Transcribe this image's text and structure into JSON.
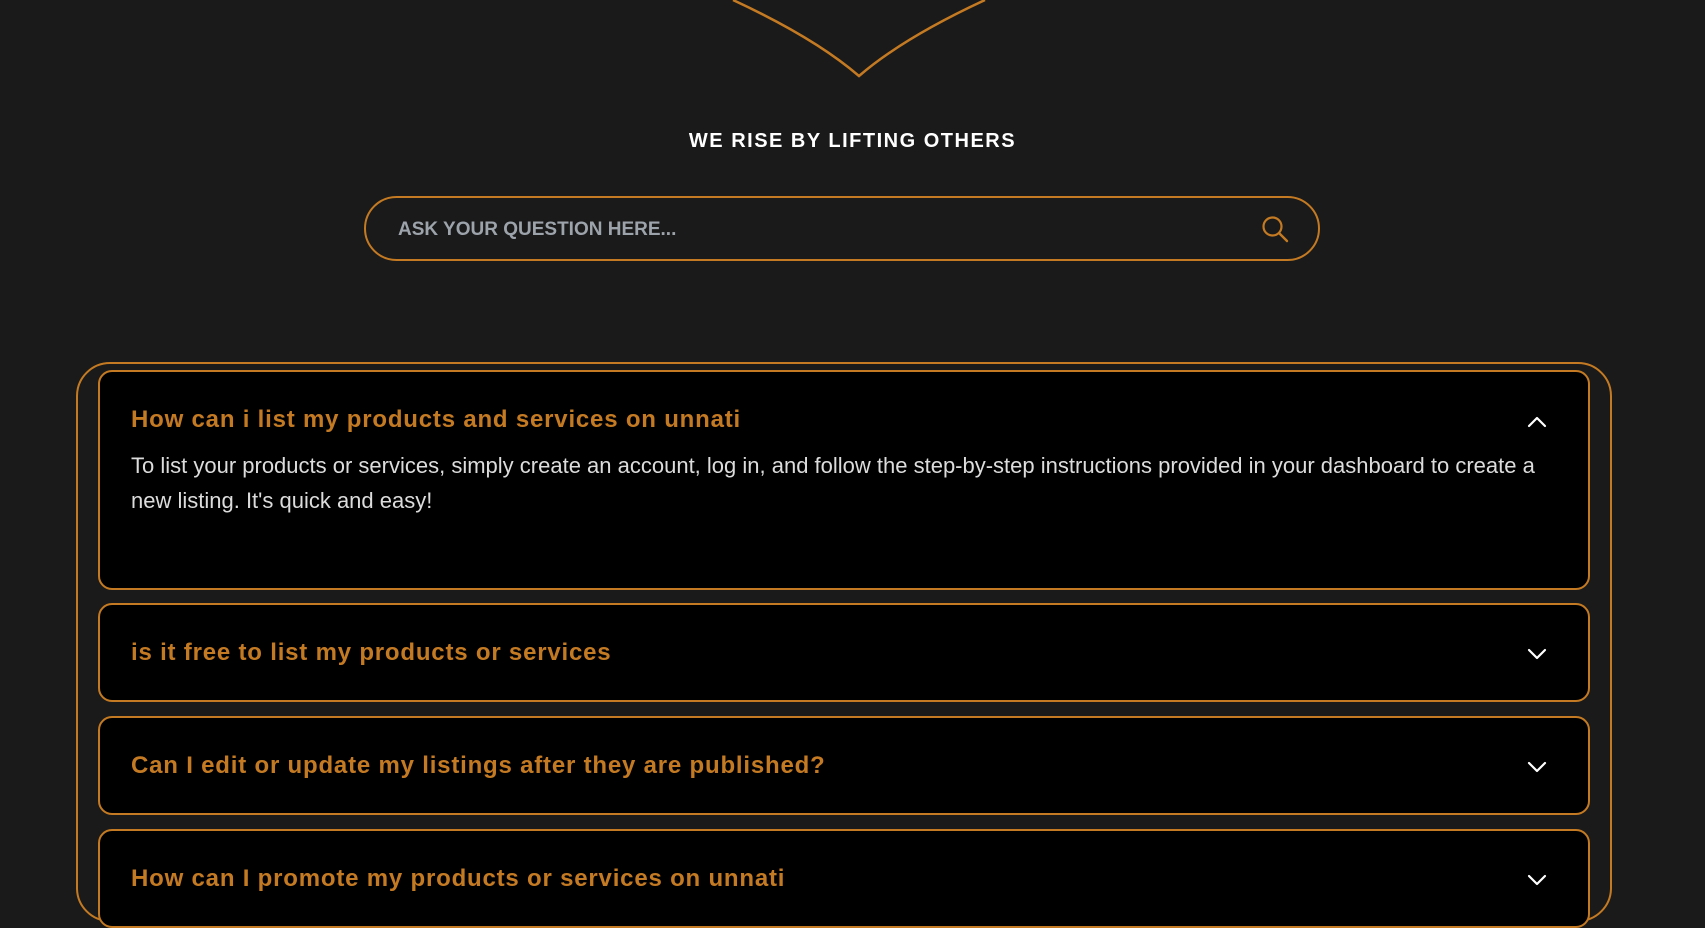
{
  "tagline": "WE RISE BY LIFTING OTHERS",
  "search": {
    "placeholder": "ASK YOUR QUESTION HERE...",
    "icon": "search-icon"
  },
  "colors": {
    "accent": "#c47a22",
    "background": "#1a1a1a",
    "card_background": "#000000",
    "heading_text": "#ffffff",
    "answer_text": "#dcdcdc"
  },
  "faq": {
    "items": [
      {
        "question": "How can i list my products and services on unnati",
        "answer": "To list your products or services, simply create an account, log in, and follow the step-by-step instructions provided in your dashboard to create a new listing. It's quick and easy!",
        "expanded": true,
        "icon": "chevron-up-icon"
      },
      {
        "question": "is it free to list my products or services",
        "expanded": false,
        "icon": "chevron-down-icon"
      },
      {
        "question": "Can I edit or update my listings after they are published?",
        "expanded": false,
        "icon": "chevron-down-icon"
      },
      {
        "question": "How can I promote my products or services on unnati",
        "expanded": false,
        "icon": "chevron-down-icon"
      }
    ]
  }
}
